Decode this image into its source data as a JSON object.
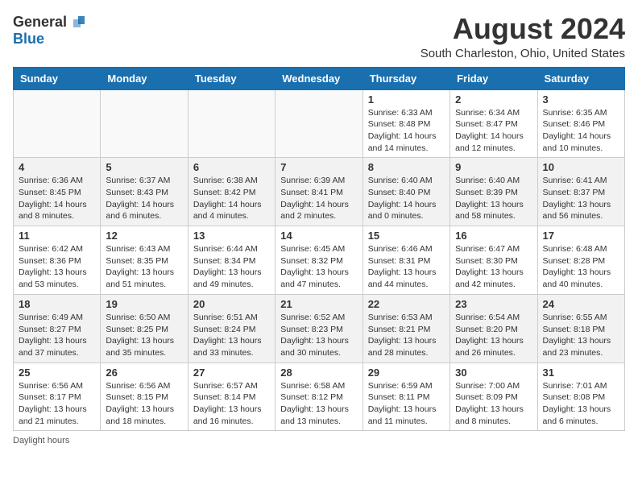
{
  "logo": {
    "general": "General",
    "blue": "Blue"
  },
  "title": {
    "month_year": "August 2024",
    "location": "South Charleston, Ohio, United States"
  },
  "days_of_week": [
    "Sunday",
    "Monday",
    "Tuesday",
    "Wednesday",
    "Thursday",
    "Friday",
    "Saturday"
  ],
  "weeks": [
    [
      {
        "day": "",
        "info": ""
      },
      {
        "day": "",
        "info": ""
      },
      {
        "day": "",
        "info": ""
      },
      {
        "day": "",
        "info": ""
      },
      {
        "day": "1",
        "info": "Sunrise: 6:33 AM\nSunset: 8:48 PM\nDaylight: 14 hours\nand 14 minutes."
      },
      {
        "day": "2",
        "info": "Sunrise: 6:34 AM\nSunset: 8:47 PM\nDaylight: 14 hours\nand 12 minutes."
      },
      {
        "day": "3",
        "info": "Sunrise: 6:35 AM\nSunset: 8:46 PM\nDaylight: 14 hours\nand 10 minutes."
      }
    ],
    [
      {
        "day": "4",
        "info": "Sunrise: 6:36 AM\nSunset: 8:45 PM\nDaylight: 14 hours\nand 8 minutes."
      },
      {
        "day": "5",
        "info": "Sunrise: 6:37 AM\nSunset: 8:43 PM\nDaylight: 14 hours\nand 6 minutes."
      },
      {
        "day": "6",
        "info": "Sunrise: 6:38 AM\nSunset: 8:42 PM\nDaylight: 14 hours\nand 4 minutes."
      },
      {
        "day": "7",
        "info": "Sunrise: 6:39 AM\nSunset: 8:41 PM\nDaylight: 14 hours\nand 2 minutes."
      },
      {
        "day": "8",
        "info": "Sunrise: 6:40 AM\nSunset: 8:40 PM\nDaylight: 14 hours\nand 0 minutes."
      },
      {
        "day": "9",
        "info": "Sunrise: 6:40 AM\nSunset: 8:39 PM\nDaylight: 13 hours\nand 58 minutes."
      },
      {
        "day": "10",
        "info": "Sunrise: 6:41 AM\nSunset: 8:37 PM\nDaylight: 13 hours\nand 56 minutes."
      }
    ],
    [
      {
        "day": "11",
        "info": "Sunrise: 6:42 AM\nSunset: 8:36 PM\nDaylight: 13 hours\nand 53 minutes."
      },
      {
        "day": "12",
        "info": "Sunrise: 6:43 AM\nSunset: 8:35 PM\nDaylight: 13 hours\nand 51 minutes."
      },
      {
        "day": "13",
        "info": "Sunrise: 6:44 AM\nSunset: 8:34 PM\nDaylight: 13 hours\nand 49 minutes."
      },
      {
        "day": "14",
        "info": "Sunrise: 6:45 AM\nSunset: 8:32 PM\nDaylight: 13 hours\nand 47 minutes."
      },
      {
        "day": "15",
        "info": "Sunrise: 6:46 AM\nSunset: 8:31 PM\nDaylight: 13 hours\nand 44 minutes."
      },
      {
        "day": "16",
        "info": "Sunrise: 6:47 AM\nSunset: 8:30 PM\nDaylight: 13 hours\nand 42 minutes."
      },
      {
        "day": "17",
        "info": "Sunrise: 6:48 AM\nSunset: 8:28 PM\nDaylight: 13 hours\nand 40 minutes."
      }
    ],
    [
      {
        "day": "18",
        "info": "Sunrise: 6:49 AM\nSunset: 8:27 PM\nDaylight: 13 hours\nand 37 minutes."
      },
      {
        "day": "19",
        "info": "Sunrise: 6:50 AM\nSunset: 8:25 PM\nDaylight: 13 hours\nand 35 minutes."
      },
      {
        "day": "20",
        "info": "Sunrise: 6:51 AM\nSunset: 8:24 PM\nDaylight: 13 hours\nand 33 minutes."
      },
      {
        "day": "21",
        "info": "Sunrise: 6:52 AM\nSunset: 8:23 PM\nDaylight: 13 hours\nand 30 minutes."
      },
      {
        "day": "22",
        "info": "Sunrise: 6:53 AM\nSunset: 8:21 PM\nDaylight: 13 hours\nand 28 minutes."
      },
      {
        "day": "23",
        "info": "Sunrise: 6:54 AM\nSunset: 8:20 PM\nDaylight: 13 hours\nand 26 minutes."
      },
      {
        "day": "24",
        "info": "Sunrise: 6:55 AM\nSunset: 8:18 PM\nDaylight: 13 hours\nand 23 minutes."
      }
    ],
    [
      {
        "day": "25",
        "info": "Sunrise: 6:56 AM\nSunset: 8:17 PM\nDaylight: 13 hours\nand 21 minutes."
      },
      {
        "day": "26",
        "info": "Sunrise: 6:56 AM\nSunset: 8:15 PM\nDaylight: 13 hours\nand 18 minutes."
      },
      {
        "day": "27",
        "info": "Sunrise: 6:57 AM\nSunset: 8:14 PM\nDaylight: 13 hours\nand 16 minutes."
      },
      {
        "day": "28",
        "info": "Sunrise: 6:58 AM\nSunset: 8:12 PM\nDaylight: 13 hours\nand 13 minutes."
      },
      {
        "day": "29",
        "info": "Sunrise: 6:59 AM\nSunset: 8:11 PM\nDaylight: 13 hours\nand 11 minutes."
      },
      {
        "day": "30",
        "info": "Sunrise: 7:00 AM\nSunset: 8:09 PM\nDaylight: 13 hours\nand 8 minutes."
      },
      {
        "day": "31",
        "info": "Sunrise: 7:01 AM\nSunset: 8:08 PM\nDaylight: 13 hours\nand 6 minutes."
      }
    ]
  ],
  "footer": {
    "note": "Daylight hours"
  }
}
